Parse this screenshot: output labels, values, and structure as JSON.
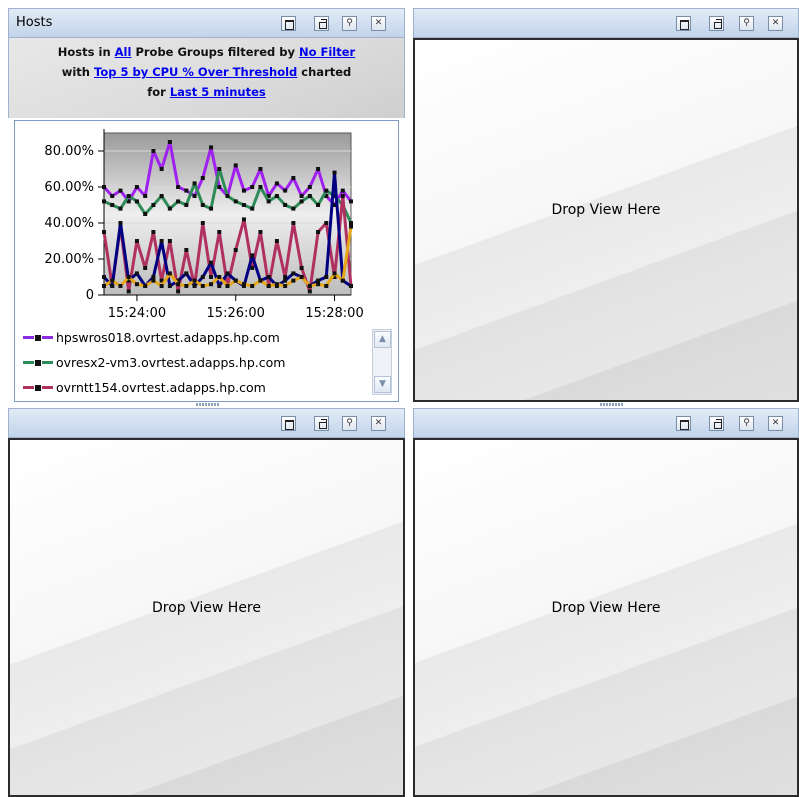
{
  "panels": {
    "top_left": {
      "title": "Hosts",
      "filter": {
        "line1_prefix": "Hosts in ",
        "probe_groups_link": "All",
        "line1_middle": " Probe Groups filtered by ",
        "filter_link": "No Filter",
        "line2_prefix": "with ",
        "metric_link": "Top 5 by CPU % Over Threshold",
        "line2_suffix": " charted",
        "line3_prefix": "for ",
        "time_link": "Last 5 minutes"
      },
      "legend": [
        {
          "label": "hpswros018.ovrtest.adapps.hp.com",
          "color": "#8a2be2"
        },
        {
          "label": "ovresx2-vm3.ovrtest.adapps.hp.com",
          "color": "#2e8b57"
        },
        {
          "label": "ovrntt154.ovrtest.adapps.hp.com",
          "color": "#b03060"
        }
      ],
      "scroll_up_icon": "▲",
      "scroll_down_icon": "▼"
    },
    "top_right": {
      "drop_label": "Drop View Here"
    },
    "bottom_left": {
      "drop_label": "Drop View Here"
    },
    "bottom_right": {
      "drop_label": "Drop View Here"
    }
  },
  "window_buttons": {
    "maximize_icon": "maximize-icon",
    "restore_icon": "restore-icon",
    "pin_label": "⚲",
    "close_label": "✕"
  },
  "chart_data": {
    "type": "line",
    "x": [
      "15:23:20",
      "15:23:30",
      "15:23:40",
      "15:23:50",
      "15:24:00",
      "15:24:10",
      "15:24:20",
      "15:24:30",
      "15:24:40",
      "15:24:50",
      "15:25:00",
      "15:25:10",
      "15:25:20",
      "15:25:30",
      "15:25:40",
      "15:25:50",
      "15:26:00",
      "15:26:10",
      "15:26:20",
      "15:26:30",
      "15:26:40",
      "15:26:50",
      "15:27:00",
      "15:27:10",
      "15:27:20",
      "15:27:30",
      "15:27:40",
      "15:27:50",
      "15:28:00",
      "15:28:10",
      "15:28:20"
    ],
    "x_ticks": [
      "15:24:00",
      "15:26:00",
      "15:28:00"
    ],
    "y_ticks": [
      "0",
      "20.00%",
      "40.00%",
      "60.00%",
      "80.00%"
    ],
    "ylim": [
      0,
      90
    ],
    "grid": true,
    "series": [
      {
        "name": "hpswros018.ovrtest.adapps.hp.com",
        "color": "#a020f0",
        "values": [
          60,
          55,
          58,
          52,
          60,
          55,
          80,
          70,
          85,
          60,
          58,
          55,
          65,
          82,
          60,
          55,
          72,
          58,
          60,
          70,
          55,
          62,
          58,
          65,
          55,
          60,
          70,
          55,
          50,
          58,
          52
        ]
      },
      {
        "name": "ovresx2-vm3.ovrtest.adapps.hp.com",
        "color": "#2e8b57",
        "values": [
          52,
          50,
          48,
          55,
          52,
          45,
          50,
          55,
          48,
          52,
          50,
          62,
          50,
          48,
          70,
          55,
          52,
          50,
          48,
          60,
          52,
          55,
          50,
          48,
          52,
          55,
          50,
          58,
          55,
          50,
          40
        ]
      },
      {
        "name": "ovrntt154.ovrtest.adapps.hp.com",
        "color": "#b03060",
        "values": [
          35,
          5,
          38,
          2,
          30,
          15,
          35,
          8,
          30,
          2,
          25,
          5,
          40,
          10,
          35,
          5,
          25,
          42,
          15,
          35,
          5,
          30,
          10,
          40,
          15,
          2,
          35,
          40,
          10,
          55,
          5
        ]
      },
      {
        "name": "",
        "color": "#000080",
        "values": [
          10,
          5,
          40,
          8,
          12,
          5,
          10,
          30,
          5,
          8,
          12,
          5,
          10,
          18,
          5,
          12,
          8,
          5,
          22,
          8,
          10,
          5,
          8,
          12,
          10,
          5,
          8,
          10,
          68,
          8,
          5
        ]
      },
      {
        "name": "",
        "color": "#e6a817",
        "values": [
          5,
          8,
          5,
          10,
          6,
          5,
          8,
          5,
          12,
          6,
          5,
          8,
          5,
          6,
          10,
          5,
          8,
          6,
          5,
          8,
          5,
          6,
          5,
          8,
          10,
          5,
          6,
          5,
          12,
          8,
          38
        ]
      }
    ]
  }
}
